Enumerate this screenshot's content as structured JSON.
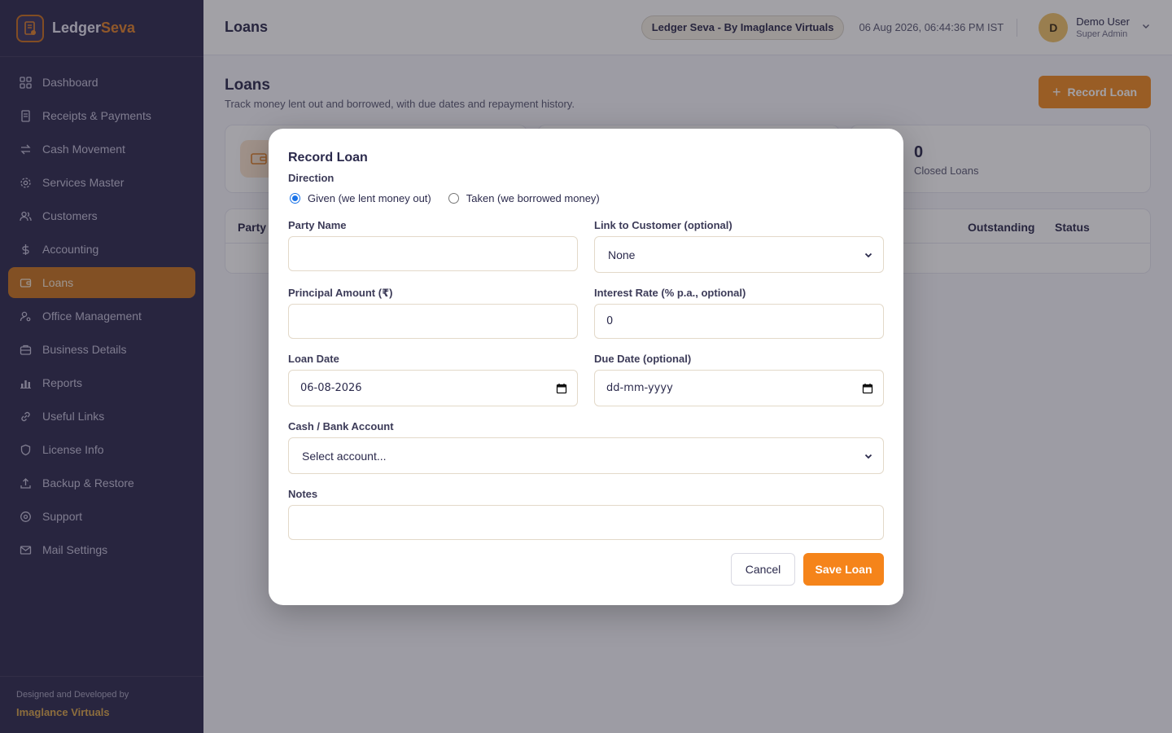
{
  "brand": {
    "name_part1": "Ledger",
    "name_part2": "Seva"
  },
  "sidebar": {
    "items": [
      {
        "label": "Dashboard",
        "icon": "grid-icon"
      },
      {
        "label": "Receipts & Payments",
        "icon": "receipt-icon"
      },
      {
        "label": "Cash Movement",
        "icon": "transfer-icon"
      },
      {
        "label": "Services Master",
        "icon": "gear-icon"
      },
      {
        "label": "Customers",
        "icon": "users-icon"
      },
      {
        "label": "Accounting",
        "icon": "dollar-icon"
      },
      {
        "label": "Loans",
        "icon": "wallet-icon",
        "active": true
      },
      {
        "label": "Office Management",
        "icon": "user-cog-icon"
      },
      {
        "label": "Business Details",
        "icon": "briefcase-icon"
      },
      {
        "label": "Reports",
        "icon": "bar-chart-icon"
      },
      {
        "label": "Useful Links",
        "icon": "link-icon"
      },
      {
        "label": "License Info",
        "icon": "shield-icon"
      },
      {
        "label": "Backup & Restore",
        "icon": "upload-icon"
      },
      {
        "label": "Support",
        "icon": "help-circle-icon"
      },
      {
        "label": "Mail Settings",
        "icon": "mail-icon"
      }
    ],
    "footer": {
      "designed_by": "Designed and Developed by",
      "company": "Imaglance Virtuals"
    }
  },
  "header": {
    "title": "Loans",
    "pill": "Ledger Seva - By Imaglance Virtuals",
    "datetime": "06 Aug 2026, 06:44:36 PM IST",
    "user": {
      "initial": "D",
      "name": "Demo User",
      "role": "Super Admin"
    }
  },
  "main": {
    "title": "Loans",
    "subtitle": "Track money lent out and borrowed, with due dates and repayment history.",
    "record_button": "Record Loan",
    "stat_cards": [
      {
        "value": "",
        "label": ""
      },
      {
        "value": "",
        "label": ""
      },
      {
        "value": "0",
        "label": "Closed Loans"
      }
    ],
    "table_headers": {
      "party": "Party",
      "outstanding": "Outstanding",
      "status": "Status"
    }
  },
  "modal": {
    "title": "Record Loan",
    "direction_label": "Direction",
    "direction_options": [
      {
        "label": "Given (we lent money out)",
        "checked": true
      },
      {
        "label": "Taken (we borrowed money)",
        "checked": false
      }
    ],
    "party_name_label": "Party Name",
    "party_name_value": "",
    "link_customer_label": "Link to Customer (optional)",
    "link_customer_value": "None",
    "principal_label": "Principal Amount (₹)",
    "principal_value": "",
    "interest_label": "Interest Rate (% p.a., optional)",
    "interest_value": "0",
    "loan_date_label": "Loan Date",
    "loan_date_value": "06-08-2026",
    "due_date_label": "Due Date (optional)",
    "due_date_placeholder": "dd-mm-yyyy",
    "account_label": "Cash / Bank Account",
    "account_value": "Select account...",
    "notes_label": "Notes",
    "notes_value": "",
    "cancel_button": "Cancel",
    "save_button": "Save Loan"
  },
  "colors": {
    "sidebar_bg": "#2e2a4f",
    "accent": "#f08a22",
    "active_nav": "#c8741f"
  }
}
